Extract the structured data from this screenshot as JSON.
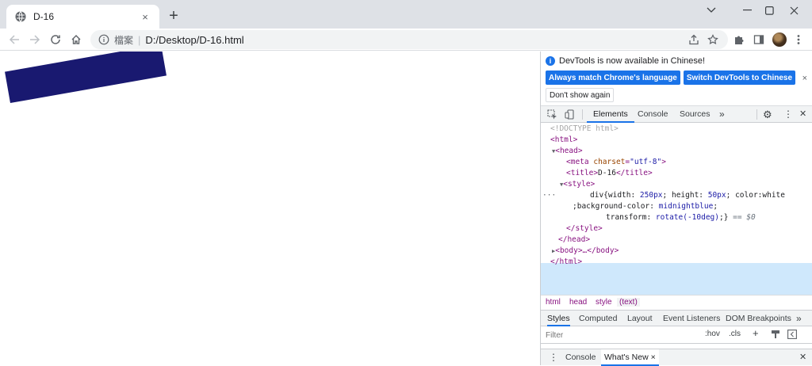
{
  "tab": {
    "title": "D-16",
    "close": "×",
    "new_tab": "+"
  },
  "window_controls": {
    "minimize": "—",
    "maximize": "☐",
    "close": "✕",
    "tab_search": "⌄"
  },
  "toolbar": {
    "back": "←",
    "forward": "→",
    "reload": "↻",
    "home": "⌂",
    "site_label": "檔案",
    "separator": "|",
    "url": "D:/Desktop/D-16.html",
    "share": "⇪",
    "bookmark": "☆",
    "extensions": "✦",
    "side_panel": "▮",
    "menu": "⋮"
  },
  "page": {
    "demo_color": "#191970"
  },
  "devtools": {
    "infobar": {
      "message": "DevTools is now available in Chinese!",
      "info_icon": "i",
      "btn_match": "Always match Chrome's language",
      "btn_switch": "Switch DevTools to Chinese",
      "btn_dont_show": "Don't show again",
      "dismiss": "×"
    },
    "tabs": {
      "elements": "Elements",
      "console": "Console",
      "sources": "Sources",
      "more": "»",
      "settings": "⚙",
      "kebab": "⋮",
      "close": "✕"
    },
    "dom": {
      "doctype": "<!DOCTYPE html>",
      "html_open": "<html>",
      "head_open": "<head>",
      "meta_tag": "meta",
      "meta_attr": "charset",
      "meta_val": "\"utf-8\"",
      "title_open": "<title>",
      "title_text": "D-16",
      "title_close": "</title>",
      "style_open": "<style>",
      "css_line1_a": "div{width: ",
      "css_line1_v1": "250px",
      "css_line1_b": "; height: ",
      "css_line1_v2": "50px",
      "css_line1_c": "; color:white",
      "css_line2_a": ";background-color: ",
      "css_line2_v": "midnightblue",
      "css_line2_b": ";",
      "css_line3_a": "transform: ",
      "css_line3_v": "rotate(-10deg)",
      "css_line3_b": ";}",
      "css_sel_hint": " == $0",
      "style_close": "</style>",
      "head_close": "</head>",
      "body_collapsed": "<body>…</body>",
      "html_close": "</html>",
      "dots": "···"
    },
    "breadcrumbs": [
      "html",
      "head",
      "style",
      "(text)"
    ],
    "subtabs": [
      "Styles",
      "Computed",
      "Layout",
      "Event Listeners",
      "DOM Breakpoints",
      "»"
    ],
    "filter": {
      "placeholder": "Filter",
      "hov": ":hov",
      "cls": ".cls",
      "plus": "+"
    },
    "drawer": {
      "kebab": "⋮",
      "console": "Console",
      "whats_new": "What's New",
      "whats_new_close": "×",
      "close": "✕"
    }
  }
}
